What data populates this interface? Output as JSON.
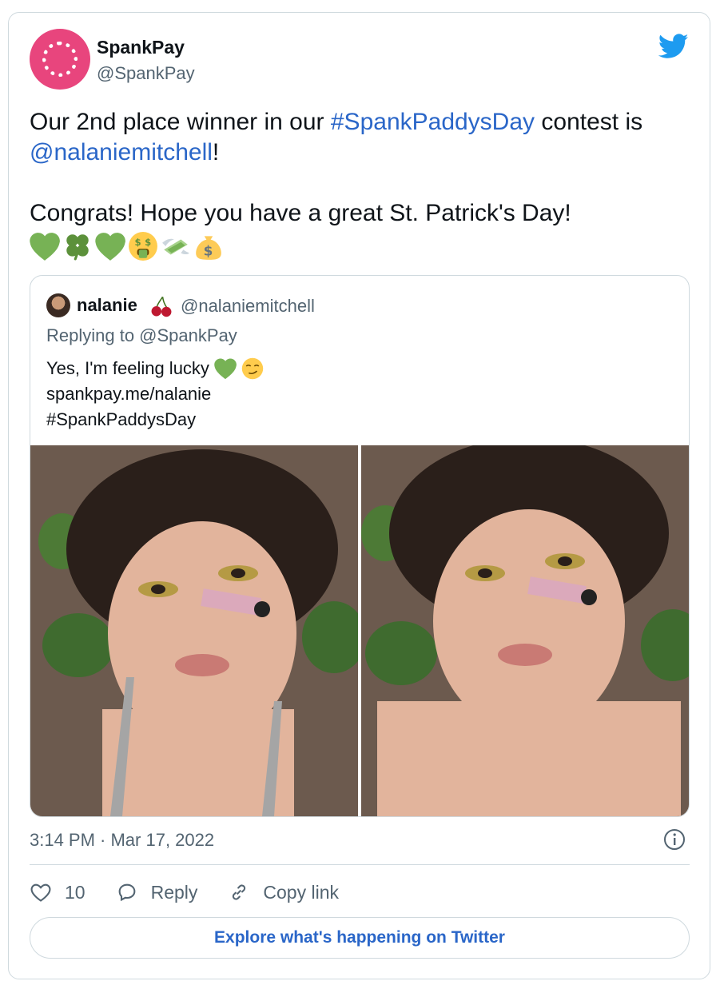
{
  "author": {
    "display_name": "SpankPay",
    "handle": "@SpankPay"
  },
  "tweet": {
    "line1_prefix": "Our 2nd place winner in our ",
    "line1_hashtag": "#SpankPaddysDay",
    "line1_suffix": " contest is",
    "line2_mention": "@nalaniemitchell",
    "line2_suffix": "!",
    "line3": "Congrats! Hope you have a great St. Patrick's Day!",
    "emojis": [
      "green-heart",
      "shamrock",
      "green-heart",
      "money-mouth-face",
      "money-with-wings",
      "money-bag"
    ]
  },
  "quoted": {
    "display_name": "nalanie",
    "name_emoji": "cherries",
    "handle": "@nalaniemitchell",
    "replying_to": "Replying to @SpankPay",
    "line1": "Yes, I'm feeling lucky",
    "line1_emojis": [
      "green-heart",
      "smirking-face"
    ],
    "line2": "spankpay.me/nalanie",
    "line3": "#SpankPaddysDay",
    "photos": [
      "selfie-photo-1",
      "selfie-photo-2"
    ]
  },
  "meta": {
    "timestamp": "3:14 PM · Mar 17, 2022"
  },
  "actions": {
    "like_count": "10",
    "reply_label": "Reply",
    "copy_label": "Copy link"
  },
  "cta": {
    "label": "Explore what's happening on Twitter"
  },
  "colors": {
    "link": "#2a66c8",
    "muted": "#536471",
    "brand_pink": "#e8457d",
    "twitter_blue": "#1d9bf0",
    "border": "#cfd9de"
  }
}
